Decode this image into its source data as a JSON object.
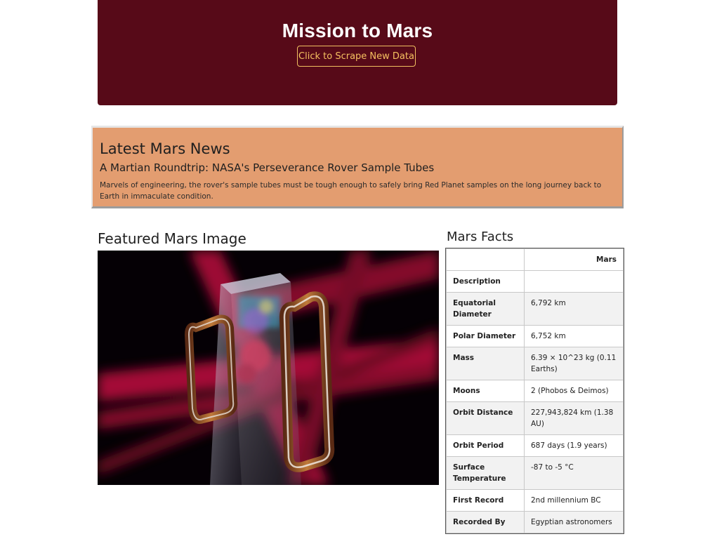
{
  "header": {
    "title": "Mission to Mars",
    "scrape_button_label": "Click to Scrape New Data",
    "background_color": "#570a18",
    "button_color": "#f5c060"
  },
  "news": {
    "section_title": "Latest Mars News",
    "headline": "A Martian Roundtrip: NASA's Perseverance Rover Sample Tubes",
    "teaser": "Marvels of engineering, the rover's sample tubes must be tough enough to safely bring Red Planet samples on the long journey back to Earth in immaculate condition.",
    "background_color": "#e39d70"
  },
  "featured": {
    "section_title": "Featured Mars Image"
  },
  "facts": {
    "section_title": "Mars Facts",
    "header": [
      "",
      "Mars"
    ],
    "rows": [
      {
        "label": "Description",
        "value": ""
      },
      {
        "label": "Equatorial Diameter",
        "value": "6,792 km"
      },
      {
        "label": "Polar Diameter",
        "value": "6,752 km"
      },
      {
        "label": "Mass",
        "value": "6.39 × 10^23 kg (0.11 Earths)"
      },
      {
        "label": "Moons",
        "value": "2 (Phobos & Deimos)"
      },
      {
        "label": "Orbit Distance",
        "value": "227,943,824 km (1.38 AU)"
      },
      {
        "label": "Orbit Period",
        "value": "687 days (1.9 years)"
      },
      {
        "label": "Surface Temperature",
        "value": "-87 to -5 °C"
      },
      {
        "label": "First Record",
        "value": "2nd millennium BC"
      },
      {
        "label": "Recorded By",
        "value": "Egyptian astronomers"
      }
    ]
  }
}
